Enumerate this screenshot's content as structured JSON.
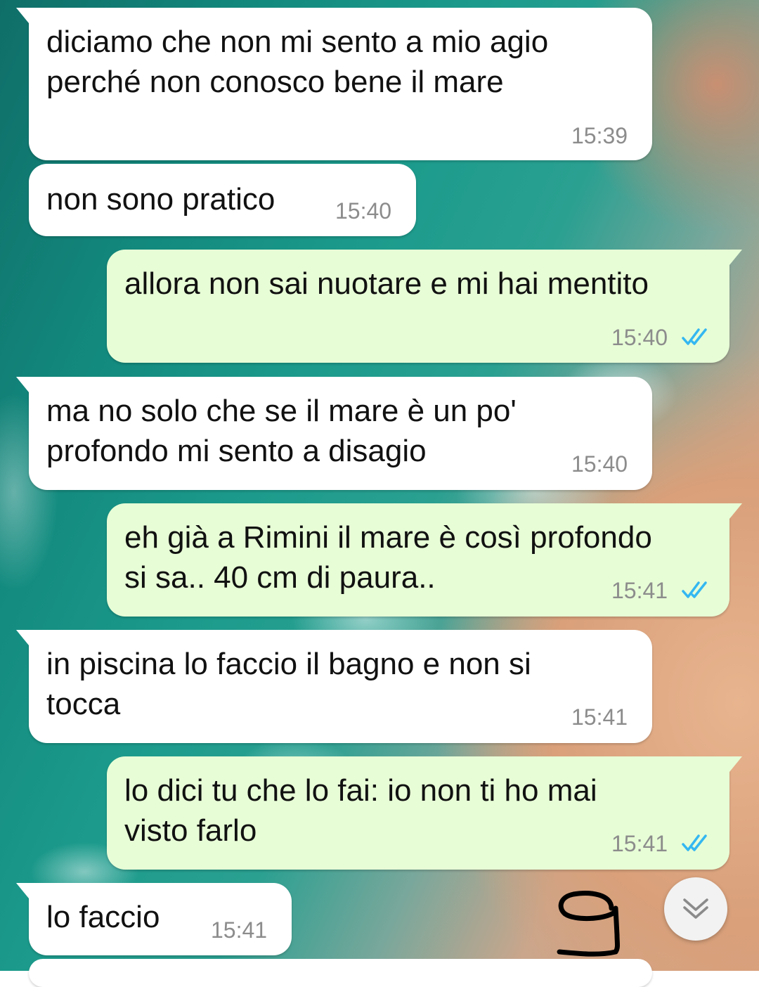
{
  "chat": {
    "messages": [
      {
        "direction": "incoming",
        "text": "diciamo che non mi sento a mio agio\nperché non conosco bene il mare",
        "time": "15:39"
      },
      {
        "direction": "incoming",
        "text": "non sono pratico",
        "time": "15:40"
      },
      {
        "direction": "outgoing",
        "text": "allora non sai nuotare e mi hai mentito",
        "time": "15:40",
        "status": "read"
      },
      {
        "direction": "incoming",
        "text": "ma no solo che se il mare è un po'\nprofondo mi sento a disagio",
        "time": "15:40"
      },
      {
        "direction": "outgoing",
        "text": "eh già a Rimini il mare è così profondo\nsi sa.. 40 cm di paura..",
        "time": "15:41",
        "status": "read"
      },
      {
        "direction": "incoming",
        "text": "in piscina lo faccio il bagno e non si\ntocca",
        "time": "15:41"
      },
      {
        "direction": "outgoing",
        "text": "lo dici tu che lo fai: io non ti ho mai\nvisto farlo",
        "time": "15:41",
        "status": "read"
      },
      {
        "direction": "incoming",
        "text": "lo faccio",
        "time": "15:41"
      }
    ]
  },
  "overlay": {
    "handwritten_number": "9",
    "scroll_button_icon": "chevron-double-down-icon"
  },
  "colors": {
    "incoming_bubble": "#ffffff",
    "outgoing_bubble": "#e7fdd6",
    "read_ticks": "#34b7f1",
    "timestamp": "#8c8c8c"
  }
}
